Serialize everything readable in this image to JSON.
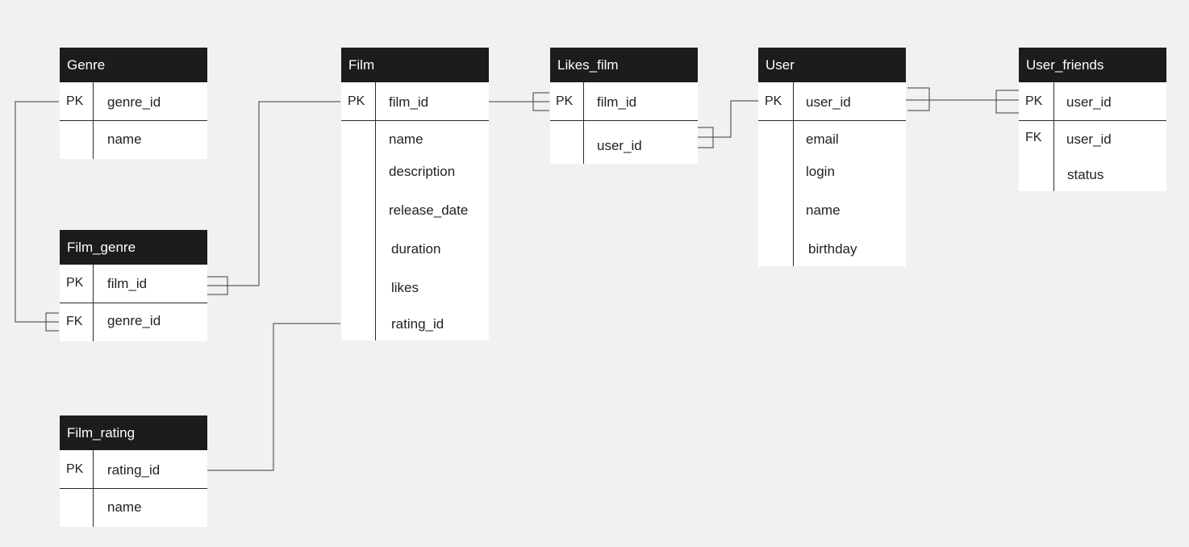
{
  "entities": {
    "genre": {
      "title": "Genre",
      "rows": [
        {
          "key": "PK",
          "field": "genre_id"
        },
        {
          "key": "",
          "field": "name"
        }
      ]
    },
    "film_genre": {
      "title": "Film_genre",
      "rows": [
        {
          "key": "PK",
          "field": "film_id"
        },
        {
          "key": "FK",
          "field": "genre_id"
        }
      ]
    },
    "film_rating": {
      "title": "Film_rating",
      "rows": [
        {
          "key": "PK",
          "field": "rating_id"
        },
        {
          "key": "",
          "field": "name"
        }
      ]
    },
    "film": {
      "title": "Film",
      "rows": [
        {
          "key": "PK",
          "field": "film_id"
        },
        {
          "key": "",
          "field": "name"
        },
        {
          "key": "",
          "field": "description"
        },
        {
          "key": "",
          "field": "release_date"
        },
        {
          "key": "",
          "field": "duration"
        },
        {
          "key": "",
          "field": "likes"
        },
        {
          "key": "",
          "field": "rating_id"
        }
      ]
    },
    "likes_film": {
      "title": "Likes_film",
      "rows": [
        {
          "key": "PK",
          "field": "film_id"
        },
        {
          "key": "",
          "field": "user_id"
        }
      ]
    },
    "user": {
      "title": "User",
      "rows": [
        {
          "key": "PK",
          "field": "user_id"
        },
        {
          "key": "",
          "field": "email"
        },
        {
          "key": "",
          "field": "login"
        },
        {
          "key": "",
          "field": "name"
        },
        {
          "key": "",
          "field": "birthday"
        }
      ]
    },
    "user_friends": {
      "title": "User_friends",
      "rows": [
        {
          "key": "PK",
          "field": "user_id"
        },
        {
          "key": "FK",
          "field": "user_id"
        },
        {
          "key": "",
          "field": "status"
        }
      ]
    }
  },
  "relationships": [
    {
      "from": "Genre.genre_id",
      "to": "Film_genre.genre_id"
    },
    {
      "from": "Film.film_id",
      "to": "Film_genre.film_id"
    },
    {
      "from": "Film_rating.rating_id",
      "to": "Film.rating_id"
    },
    {
      "from": "Film.film_id",
      "to": "Likes_film.film_id"
    },
    {
      "from": "User.user_id",
      "to": "Likes_film.user_id"
    },
    {
      "from": "User.user_id",
      "to": "User_friends.user_id"
    }
  ]
}
